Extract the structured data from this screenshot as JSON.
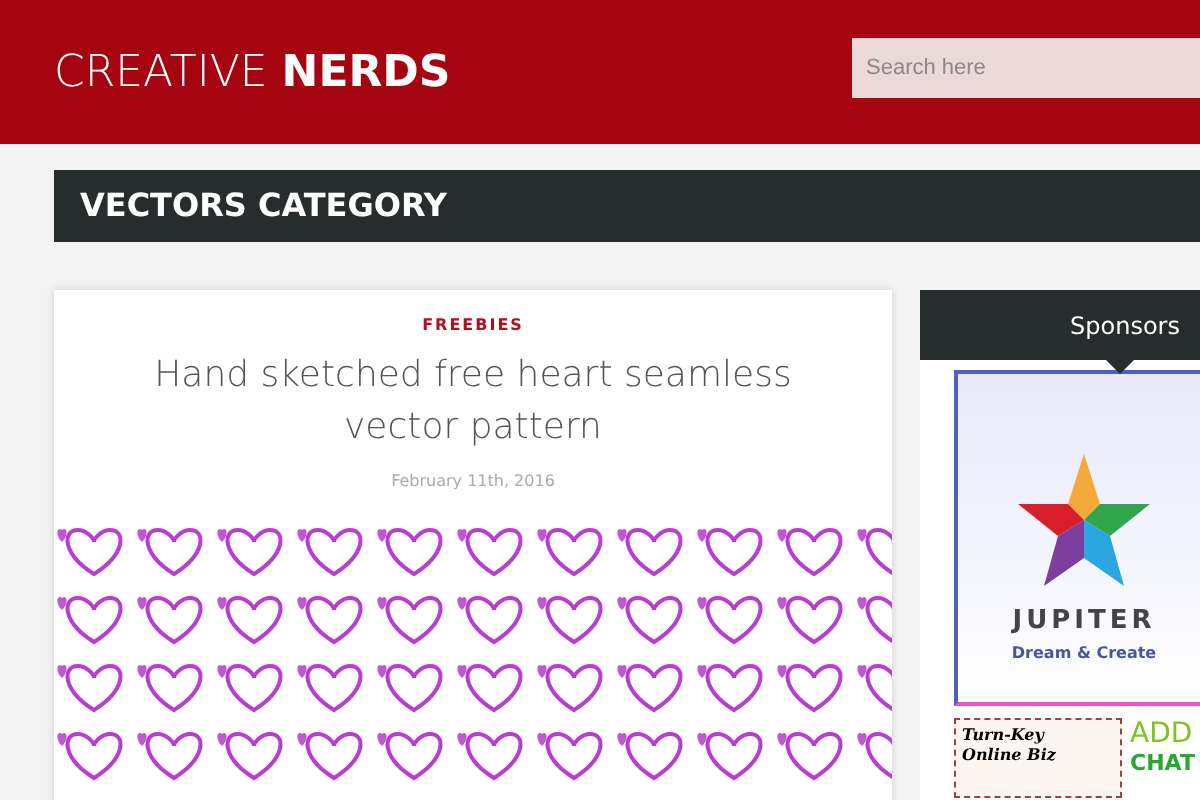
{
  "header": {
    "logo_light": "CREATIVE",
    "logo_bold": "NERDS",
    "search": {
      "placeholder": "Search here"
    }
  },
  "category_title": "VECTORS CATEGORY",
  "post": {
    "category": "FREEBIES",
    "title": "Hand sketched free heart seamless vector pattern",
    "date": "February 11th, 2016"
  },
  "sidebar": {
    "title": "Sponsors",
    "ads": [
      {
        "kind": "jupiter",
        "name": "JUPITER",
        "tagline": "Dream & Create"
      },
      {
        "kind": "turnkey",
        "line_1": "Turn-Key",
        "line_2": "Online Biz",
        "side_1": "ADD",
        "side_2": "CHAT"
      }
    ]
  }
}
